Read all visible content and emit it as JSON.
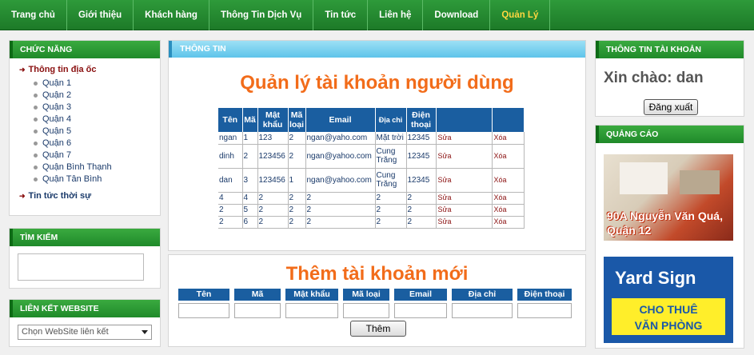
{
  "nav": {
    "items": [
      {
        "label": "Trang chủ",
        "active": false
      },
      {
        "label": "Giới thiệu",
        "active": false
      },
      {
        "label": "Khách hàng",
        "active": false
      },
      {
        "label": "Thông Tin Dịch Vụ",
        "active": false
      },
      {
        "label": "Tin tức",
        "active": false
      },
      {
        "label": "Liên hệ",
        "active": false
      },
      {
        "label": "Download",
        "active": false
      },
      {
        "label": "Quản Lý",
        "active": true
      }
    ]
  },
  "sidebar": {
    "functions_title": "CHỨC NĂNG",
    "property_info": "Thông tin địa ốc",
    "districts": [
      "Quận 1",
      "Quận 2",
      "Quận 3",
      "Quận 4",
      "Quận 5",
      "Quận 6",
      "Quận 7",
      "Quận Bình Thạnh",
      "Quận Tân Bình"
    ],
    "news": "Tin tức thời sự",
    "search_title": "TÌM KIẾM",
    "links_title": "LIÊN KẾT WEBSITE",
    "links_select": "Chọn WebSite liên kết"
  },
  "center": {
    "header": "THÔNG TIN",
    "title": "Quản lý tài khoản người dùng",
    "columns": [
      "Tên",
      "Mã",
      "Mật khẩu",
      "Mã loại",
      "Email",
      "Địa chỉ",
      "Điện thoại",
      "",
      ""
    ],
    "rows": [
      [
        "ngan",
        "1",
        "123",
        "2",
        "ngan@yaho.com",
        "Mặt trời",
        "12345",
        "Sửa",
        "Xóa"
      ],
      [
        "dinh",
        "2",
        "123456",
        "2",
        "ngan@yahoo.com",
        "Cung Trăng",
        "12345",
        "Sửa",
        "Xóa"
      ],
      [
        "dan",
        "3",
        "123456",
        "1",
        "ngan@yahoo.com",
        "Cung Trăng",
        "12345",
        "Sửa",
        "Xóa"
      ],
      [
        "4",
        "4",
        "2",
        "2",
        "2",
        "2",
        "2",
        "Sửa",
        "Xóa"
      ],
      [
        "2",
        "5",
        "2",
        "2",
        "2",
        "2",
        "2",
        "Sửa",
        "Xóa"
      ],
      [
        "2",
        "6",
        "2",
        "2",
        "2",
        "2",
        "2",
        "Sửa",
        "Xóa"
      ]
    ]
  },
  "add": {
    "title": "Thêm tài khoản mới",
    "fields": [
      "Tên",
      "Mã",
      "Mật khẩu",
      "Mã loại",
      "Email",
      "Địa chỉ",
      "Điện thoại"
    ],
    "submit": "Thêm"
  },
  "account": {
    "title": "THÔNG TIN TÀI KHOẢN",
    "greeting": "Xin chào: dan",
    "logout": "Đăng xuất"
  },
  "ads": {
    "title": "QUẢNG CÁO",
    "ad1_text": "90A Nguyễn Văn Quá, Quận 12",
    "ad2_title": "Yard Sign",
    "ad2_line1": "CHO THUÊ",
    "ad2_line2": "VĂN PHÒNG"
  },
  "colors": {
    "nav_green": "#1d7a28",
    "accent_orange": "#f26c1a",
    "table_header_blue": "#1a5ea0",
    "active_nav": "#ffd640"
  }
}
